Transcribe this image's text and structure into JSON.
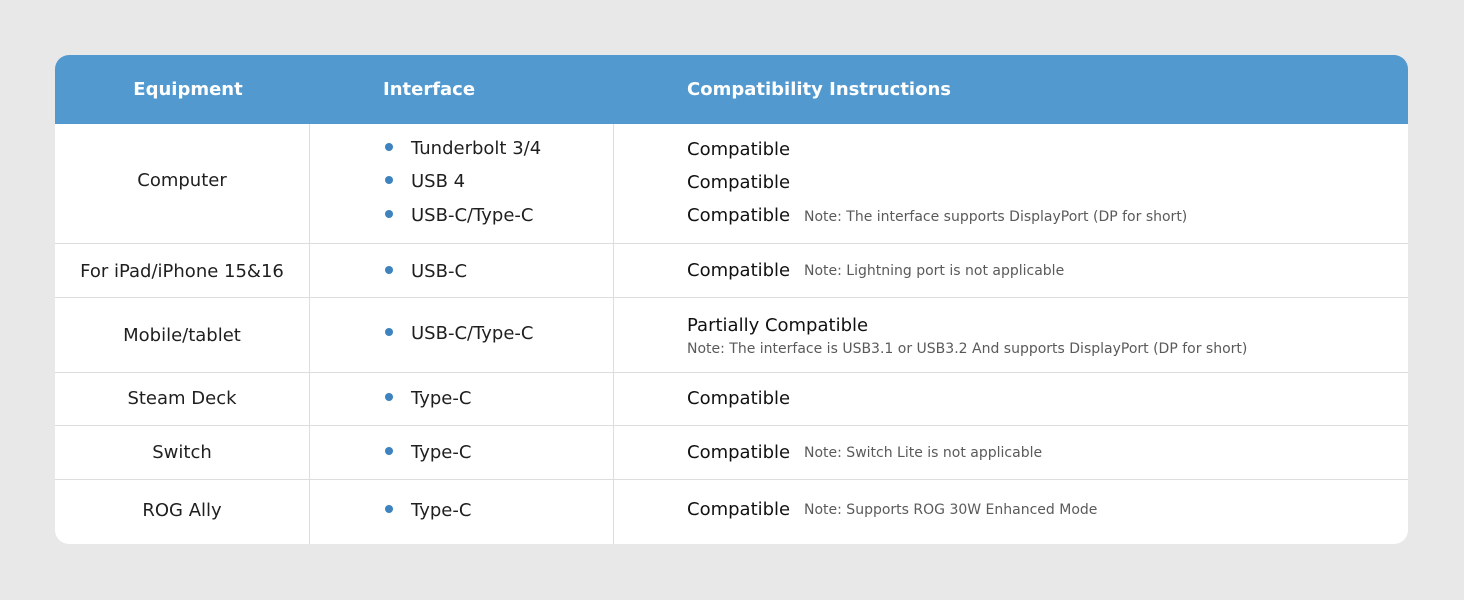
{
  "table": {
    "headers": {
      "equipment": "Equipment",
      "interface": "Interface",
      "compatibility": "Compatibility Instructions"
    },
    "rows": [
      {
        "equipment": "Computer",
        "interfaces": [
          "Tunderbolt 3/4",
          "USB 4",
          "USB-C/Type-C"
        ],
        "statuses": [
          "Compatible",
          "Compatible",
          "Compatible"
        ],
        "note": "Note: The interface supports DisplayPort (DP for short)"
      },
      {
        "equipment": "For iPad/iPhone 15&16",
        "interfaces": [
          "USB-C"
        ],
        "statuses": [
          "Compatible"
        ],
        "note": "Note: Lightning port is not applicable"
      },
      {
        "equipment": "Mobile/tablet",
        "interfaces": [
          "USB-C/Type-C"
        ],
        "statuses": [
          "Partially Compatible"
        ],
        "note": "Note: The interface is USB3.1 or USB3.2 And supports DisplayPort (DP for short)"
      },
      {
        "equipment": "Steam Deck",
        "interfaces": [
          "Type-C"
        ],
        "statuses": [
          "Compatible"
        ],
        "note": ""
      },
      {
        "equipment": "Switch",
        "interfaces": [
          "Type-C"
        ],
        "statuses": [
          "Compatible"
        ],
        "note": "Note: Switch Lite is not applicable"
      },
      {
        "equipment": "ROG Ally",
        "interfaces": [
          "Type-C"
        ],
        "statuses": [
          "Compatible"
        ],
        "note": "Note: Supports ROG 30W Enhanced Mode"
      }
    ]
  },
  "colors": {
    "header_bg": "#5299cf",
    "bullet": "#3d83c0",
    "page_bg": "#e8e8e8"
  }
}
